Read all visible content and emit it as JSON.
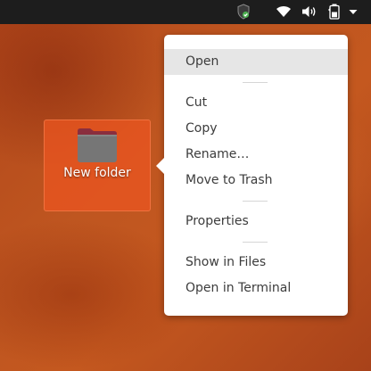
{
  "top_bar": {
    "tray": [
      {
        "icon": "shield-check-icon",
        "color": "#4caf50"
      },
      {
        "icon": "wifi-icon"
      },
      {
        "icon": "volume-icon"
      },
      {
        "icon": "battery-icon"
      },
      {
        "icon": "chevron-down-icon"
      }
    ]
  },
  "desktop": {
    "background_color": "#c0551f",
    "selected_icon": {
      "label": "New folder",
      "icon": "folder-icon",
      "highlight_color": "#e95420"
    }
  },
  "context_menu": {
    "sections": [
      [
        {
          "label": "Open",
          "hovered": true
        }
      ],
      [
        {
          "label": "Cut"
        },
        {
          "label": "Copy"
        },
        {
          "label": "Rename…"
        },
        {
          "label": "Move to Trash"
        }
      ],
      [
        {
          "label": "Properties"
        }
      ],
      [
        {
          "label": "Show in Files"
        },
        {
          "label": "Open in Terminal"
        }
      ]
    ]
  }
}
